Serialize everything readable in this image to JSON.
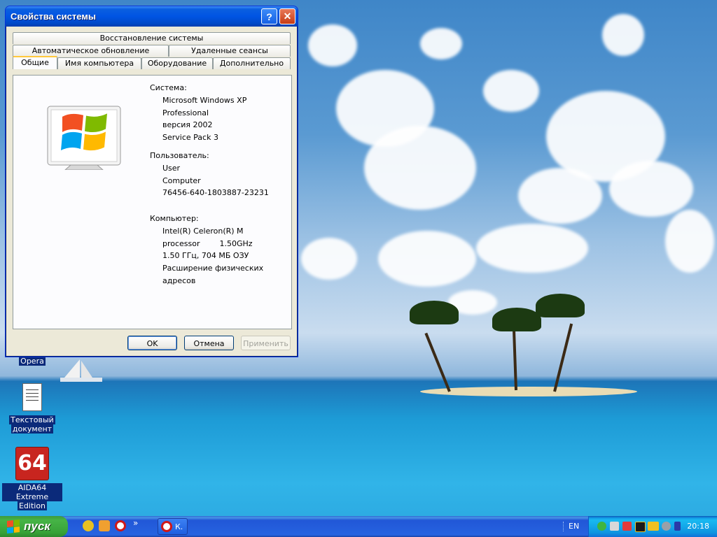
{
  "window": {
    "title": "Свойства системы",
    "tabs_row1": [
      "Восстановление системы"
    ],
    "tabs_row2": [
      "Автоматическое обновление",
      "Удаленные сеансы"
    ],
    "tabs_row3": [
      "Общие",
      "Имя компьютера",
      "Оборудование",
      "Дополнительно"
    ],
    "active_tab": "Общие",
    "system": {
      "heading": "Система:",
      "lines": [
        "Microsoft Windows XP",
        "Professional",
        "версия 2002",
        "Service Pack 3"
      ]
    },
    "user": {
      "heading": "Пользователь:",
      "lines": [
        "User",
        "Computer",
        "76456-640-1803887-23231"
      ]
    },
    "computer": {
      "heading": "Компьютер:",
      "lines": [
        "Intel(R) Celeron(R) M",
        "processor        1.50GHz",
        "1.50 ГГц, 704 МБ ОЗУ",
        "Расширение физических адресов"
      ]
    },
    "buttons": {
      "ok": "OK",
      "cancel": "Отмена",
      "apply": "Применить"
    }
  },
  "desktop": {
    "icons": [
      {
        "label": "Opera"
      },
      {
        "label_line1": "Текстовый",
        "label_line2": "документ"
      },
      {
        "label_line1": "AIDA64 Extreme",
        "label_line2": "Edition",
        "glyph": "64"
      }
    ]
  },
  "taskbar": {
    "start_label": "пуск",
    "task_label": "К.",
    "more_glyph": "»",
    "language": "EN",
    "clock": "20:18"
  }
}
